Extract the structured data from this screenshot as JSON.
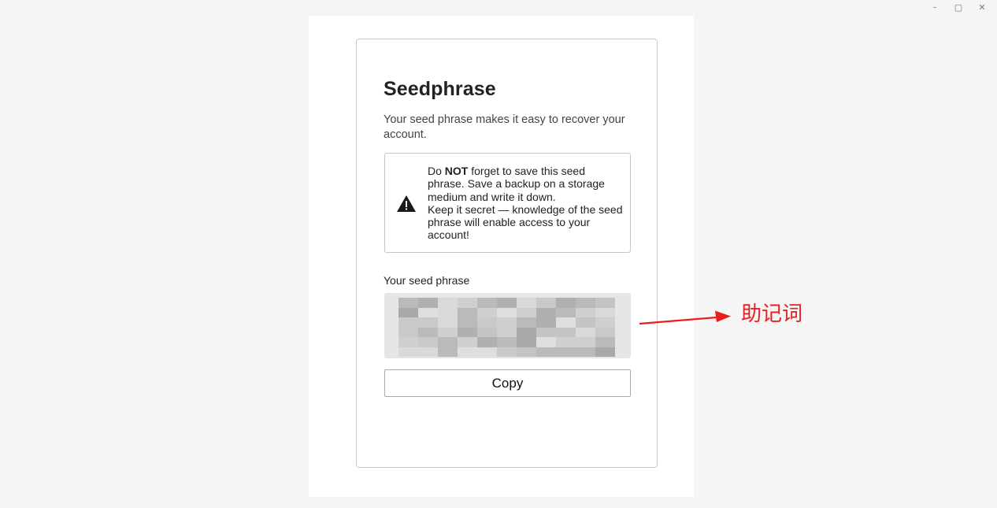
{
  "window_controls": {
    "minimize": "–",
    "maximize": "▢",
    "close": "✕"
  },
  "seed_page": {
    "title": "Seedphrase",
    "subtitle": "Your seed phrase makes it easy to recover your account.",
    "warning": {
      "icon": "warning-triangle-icon",
      "text_prefix": "Do ",
      "text_bold": "NOT",
      "text_rest": " forget to save this seed phrase. Save a backup on a storage medium and write it down.",
      "text_line2": "Keep it secret — knowledge of the seed phrase will enable access to your account!"
    },
    "seed_label": "Your seed phrase",
    "seed_value_state": "pixelated/obscured",
    "copy_label": "Copy"
  },
  "annotation": {
    "label": "助记词",
    "color": "#ee1d1d"
  },
  "colors": {
    "background": "#f5f5f5",
    "card_border": "#c9c9c9",
    "seed_box": "#e6e6e6",
    "annotation": "#ee1d1d"
  }
}
